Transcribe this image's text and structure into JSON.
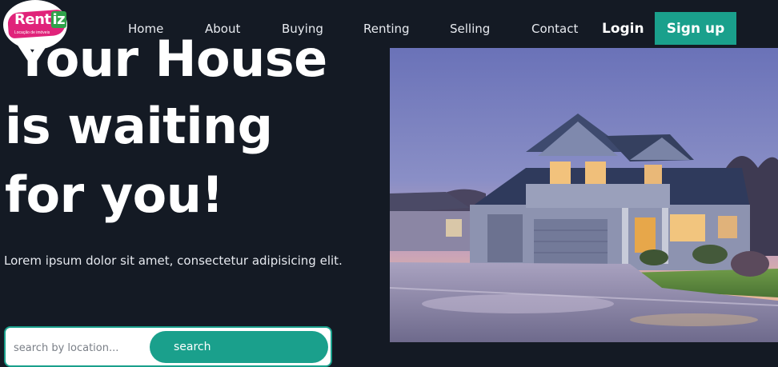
{
  "brand": {
    "logo_text": "Rent",
    "logo_accent": "iz",
    "logo_tagline": "Locação de imóveis",
    "colors": {
      "logo_pink": "#e0237a",
      "logo_green": "#2fa24a",
      "accent": "#1aa08c",
      "background": "#141a24"
    }
  },
  "nav": {
    "items": [
      {
        "label": "Home"
      },
      {
        "label": "About"
      },
      {
        "label": "Buying"
      },
      {
        "label": "Renting"
      },
      {
        "label": "Selling"
      },
      {
        "label": "Contact"
      }
    ],
    "login_label": "Login",
    "signup_label": "Sign up"
  },
  "hero": {
    "title_lines": [
      "Your House",
      "is waiting",
      "for you!"
    ],
    "lead": "Lorem ipsum dolor sit amet, consectetur adipisicing elit.",
    "image": "house-at-dusk-photo"
  },
  "search": {
    "placeholder": "search by location...",
    "value": "",
    "button_label": "search"
  }
}
